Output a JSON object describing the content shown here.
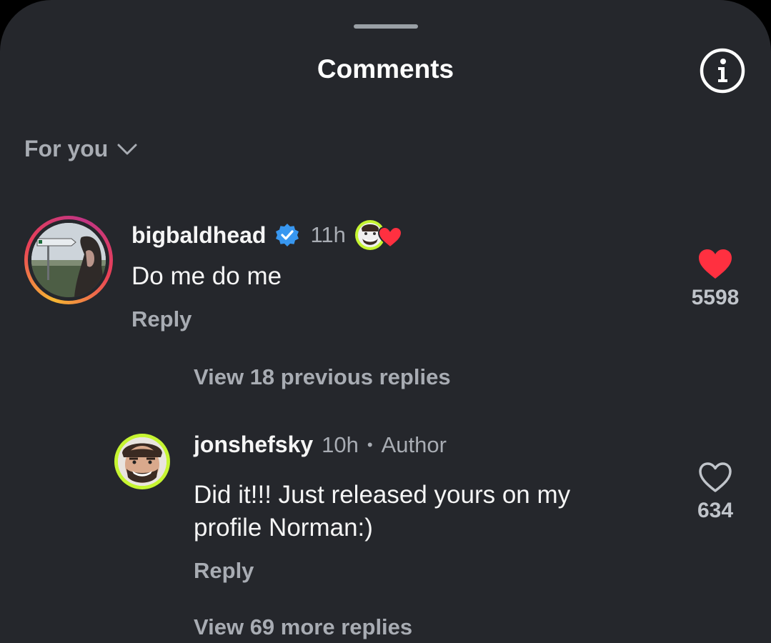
{
  "header": {
    "title": "Comments",
    "info_icon": "info-circle-icon"
  },
  "filter": {
    "label": "For you",
    "icon": "chevron-down-icon"
  },
  "comments": [
    {
      "username": "bigbaldhead",
      "verified": true,
      "time": "11h",
      "text": "Do me do me",
      "reply_label": "Reply",
      "like_count": "5598",
      "liked": true,
      "liked_by_author": true
    }
  ],
  "thread": {
    "view_previous": "View 18 previous replies",
    "reply": {
      "username": "jonshefsky",
      "time": "10h",
      "separator": "•",
      "author_badge": "Author",
      "text_line1": "Did it!!! Just released yours on my",
      "text_line2": "profile Norman:)",
      "reply_label": "Reply",
      "like_count": "634",
      "liked": false
    },
    "view_more": "View 69 more replies"
  },
  "colors": {
    "background": "#25272c",
    "like_red": "#ff3040",
    "verified_blue": "#3897f0",
    "story_ring": [
      "#f7b733",
      "#e94057",
      "#c13584"
    ],
    "close_friends_ring": "#c6f531"
  }
}
